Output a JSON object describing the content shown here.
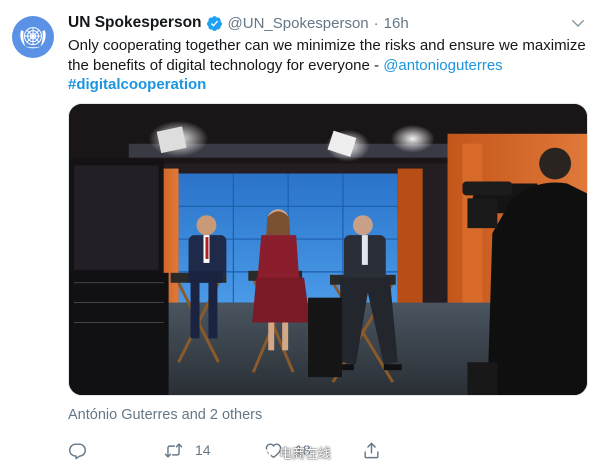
{
  "tweet": {
    "display_name": "UN Spokesperson",
    "handle": "@UN_Spokesperson",
    "separator": "·",
    "time": "16h",
    "text_before_mention": "Only cooperating together can we minimize the risks and ensure we maximize the benefits of digital technology for everyone - ",
    "mention": "@antonioguterres",
    "hashtag": "#digitalcooperation",
    "tagged": "António Guterres and 2 others",
    "avatar_icon": "un-emblem-icon",
    "verified_icon": "verified-badge-icon"
  },
  "actions": {
    "reply_icon": "reply-icon",
    "retweet_icon": "retweet-icon",
    "retweet_count": "14",
    "like_icon": "heart-icon",
    "like_count": "18",
    "share_icon": "share-icon"
  },
  "watermark": {
    "text": "电商在线"
  },
  "colors": {
    "link": "#1b95e0",
    "secondary_text": "#657786",
    "primary_text": "#14171a",
    "verified": "#1da1f2",
    "avatar_bg": "#5b92e5"
  }
}
